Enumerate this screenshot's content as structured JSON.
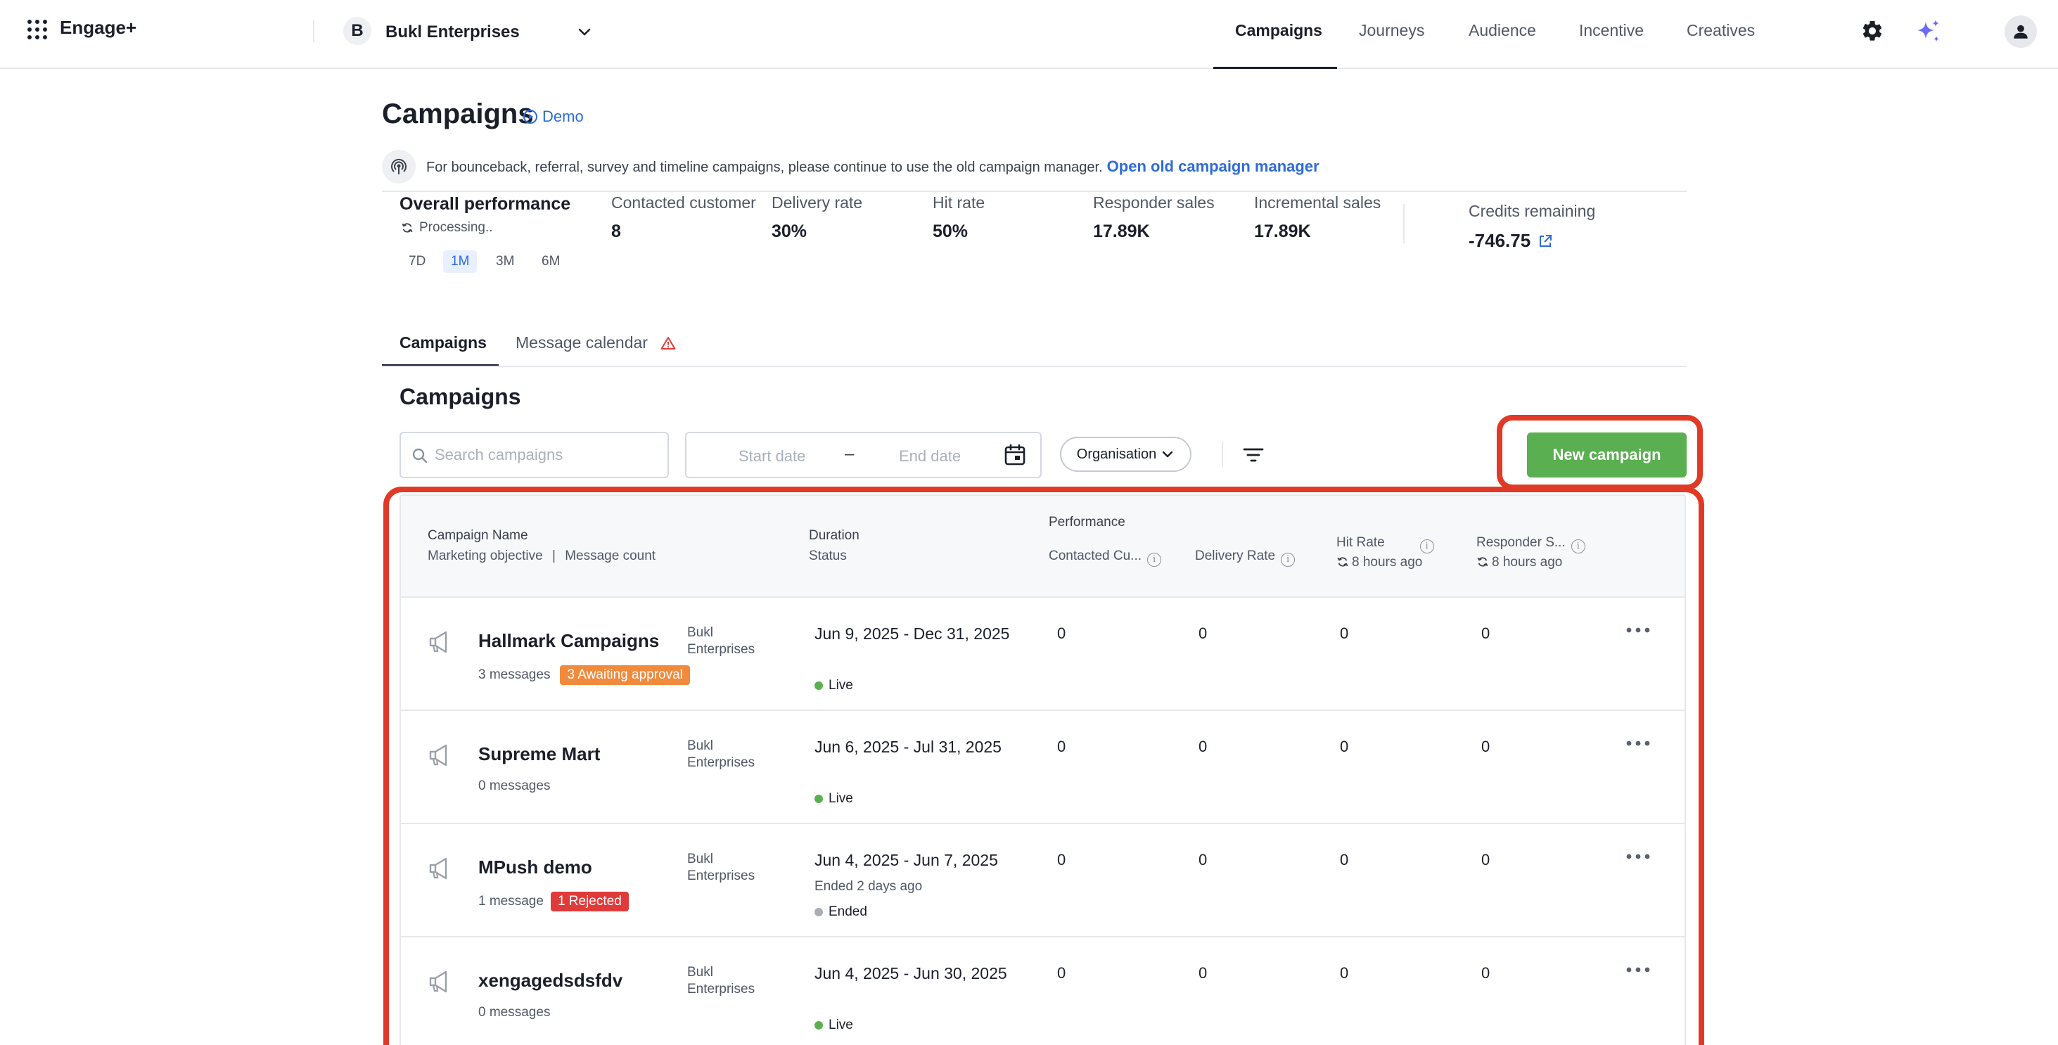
{
  "app": {
    "name": "Engage+"
  },
  "org": {
    "initial": "B",
    "name": "Bukl Enterprises"
  },
  "nav": [
    {
      "label": "Campaigns"
    },
    {
      "label": "Journeys"
    },
    {
      "label": "Audience"
    },
    {
      "label": "Incentive"
    },
    {
      "label": "Creatives"
    }
  ],
  "page": {
    "title": "Campaigns",
    "demo_label": "Demo"
  },
  "banner": {
    "text": "For bounceback, referral, survey and timeline campaigns, please continue to use the old campaign manager.",
    "link": "Open old campaign manager"
  },
  "performance": {
    "title": "Overall performance",
    "status": "Processing..",
    "ranges": [
      "7D",
      "1M",
      "3M",
      "6M"
    ],
    "selected_range": "1M",
    "metrics": [
      {
        "label": "Contacted customer",
        "value": "8"
      },
      {
        "label": "Delivery rate",
        "value": "30%"
      },
      {
        "label": "Hit rate",
        "value": "50%"
      },
      {
        "label": "Responder sales",
        "value": "17.89K"
      },
      {
        "label": "Incremental sales",
        "value": "17.89K"
      }
    ],
    "credits": {
      "label": "Credits remaining",
      "value": "-746.75"
    }
  },
  "tabs": [
    {
      "label": "Campaigns"
    },
    {
      "label": "Message calendar"
    }
  ],
  "section": {
    "title": "Campaigns"
  },
  "filters": {
    "search_placeholder": "Search campaigns",
    "start_date_placeholder": "Start date",
    "date_separator": "–",
    "end_date_placeholder": "End date",
    "org_label": "Organisation",
    "new_campaign_label": "New campaign"
  },
  "table": {
    "headers": {
      "campaign_name": "Campaign Name",
      "marketing_objective": "Marketing objective",
      "separator": "|",
      "message_count": "Message count",
      "duration": "Duration",
      "status": "Status",
      "performance": "Performance",
      "contacted": "Contacted Cu...",
      "delivery_rate": "Delivery Rate",
      "hit_rate": "Hit Rate",
      "hit_rate_updated": "8 hours ago",
      "responder_sales": "Responder S...",
      "responder_updated": "8 hours ago"
    },
    "rows": [
      {
        "name": "Hallmark Campaigns",
        "messages": "3 messages",
        "badge": "3 Awaiting approval",
        "org_line1": "Bukl",
        "org_line2": "Enterprises",
        "duration": "Jun 9, 2025 - Dec 31, 2025",
        "ended_ago": "",
        "status": "Live",
        "contacted": "0",
        "delivery": "0",
        "hit": "0",
        "responder": "0"
      },
      {
        "name": "Supreme Mart",
        "messages": "0 messages",
        "badge": "",
        "org_line1": "Bukl",
        "org_line2": "Enterprises",
        "duration": "Jun 6, 2025 - Jul 31, 2025",
        "ended_ago": "",
        "status": "Live",
        "contacted": "0",
        "delivery": "0",
        "hit": "0",
        "responder": "0"
      },
      {
        "name": "MPush demo",
        "messages": "1 message",
        "badge": "1 Rejected",
        "org_line1": "Bukl",
        "org_line2": "Enterprises",
        "duration": "Jun 4, 2025 - Jun 7, 2025",
        "ended_ago": "Ended 2 days ago",
        "status": "Ended",
        "contacted": "0",
        "delivery": "0",
        "hit": "0",
        "responder": "0"
      },
      {
        "name": "xengagedsdsfdv",
        "messages": "0 messages",
        "badge": "",
        "org_line1": "Bukl",
        "org_line2": "Enterprises",
        "duration": "Jun 4, 2025 - Jun 30, 2025",
        "ended_ago": "",
        "status": "Live",
        "contacted": "0",
        "delivery": "0",
        "hit": "0",
        "responder": "0"
      }
    ]
  },
  "colors": {
    "accent_blue": "#2e6bd8",
    "primary_green": "#5aaf50",
    "highlight_red": "#e03a27",
    "badge_orange": "#f08a3c",
    "badge_red": "#e03a3a",
    "sparkle_purple": "#6b6cf0"
  }
}
